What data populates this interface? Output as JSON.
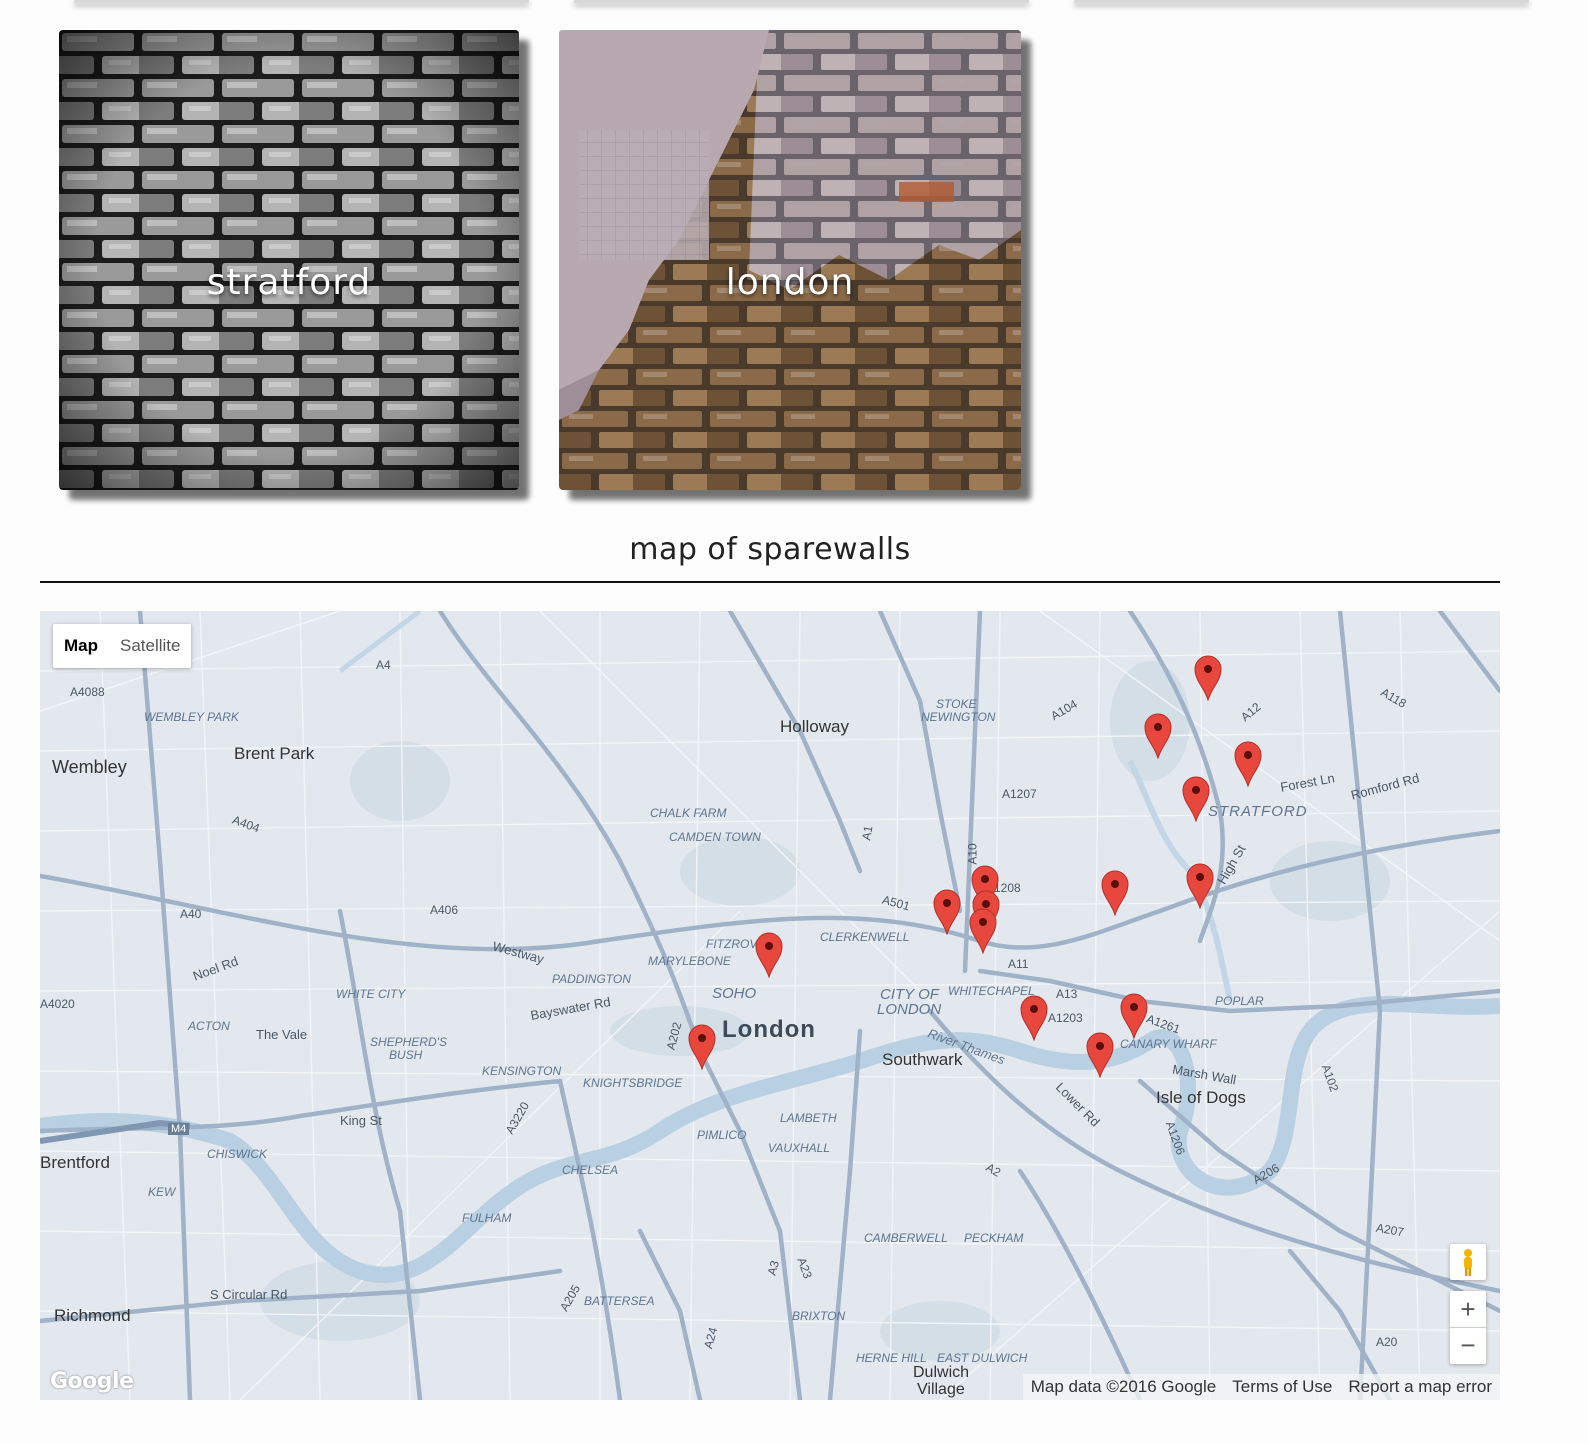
{
  "cards": [
    {
      "label": "stratford"
    },
    {
      "label": "london"
    }
  ],
  "section": {
    "title": "map of sparewalls"
  },
  "map": {
    "type_control": {
      "map_label": "Map",
      "satellite_label": "Satellite"
    },
    "zoom": {
      "in_label": "+",
      "out_label": "−"
    },
    "attribution": {
      "data": "Map data ©2016 Google",
      "terms": "Terms of Use",
      "report": "Report a map error"
    },
    "logo": "Google",
    "places_major": [
      "London"
    ],
    "places_medium": [
      "Holloway",
      "Wembley",
      "Brent Park",
      "Southwark",
      "Isle of Dogs",
      "Richmond",
      "Brentford",
      "Dulwich",
      "Village"
    ],
    "places_district": [
      "STRATFORD",
      "SOHO",
      "CITY OF",
      "LONDON",
      "WHITECHAPEL",
      "FITZROVIA",
      "MARYLEBONE",
      "PADDINGTON",
      "CLERKENWELL",
      "CHALK FARM",
      "CAMDEN TOWN",
      "STOKE",
      "NEWINGTON",
      "WEMBLEY PARK",
      "WHITE CITY",
      "ACTON",
      "SHEPHERD'S",
      "BUSH",
      "KENSINGTON",
      "KNIGHTSBRIDGE",
      "PIMLICO",
      "LAMBETH",
      "VAUXHALL",
      "CHELSEA",
      "FULHAM",
      "CHISWICK",
      "KEW",
      "BATTERSEA",
      "BRIXTON",
      "CAMBERWELL",
      "PECKHAM",
      "HERNE HILL",
      "EAST DULWICH",
      "POPLAR",
      "CANARY WHARF"
    ],
    "road_labels": [
      "A12",
      "A11",
      "A13",
      "A10",
      "A1",
      "A501",
      "A40",
      "A406",
      "A4",
      "A3",
      "A2",
      "A24",
      "A23",
      "A205",
      "A3220",
      "A202",
      "A1261",
      "A1203",
      "A1206",
      "A1208",
      "A102",
      "A206",
      "A207",
      "A20",
      "A104",
      "A1207",
      "A118",
      "M4",
      "A4020",
      "A404",
      "A4088",
      "Westway",
      "King St",
      "The Vale",
      "Noel Rd",
      "Bayswater Rd",
      "S Circular Rd",
      "Lower Rd",
      "Marsh Wall",
      "Forest Ln",
      "Romford Rd",
      "High St",
      "River Thames"
    ],
    "markers_count": 17,
    "colors": {
      "marker": "#e8473d",
      "road": "#9fb2c7",
      "water": "#b9cfe2",
      "land": "#e3e8ee"
    }
  }
}
